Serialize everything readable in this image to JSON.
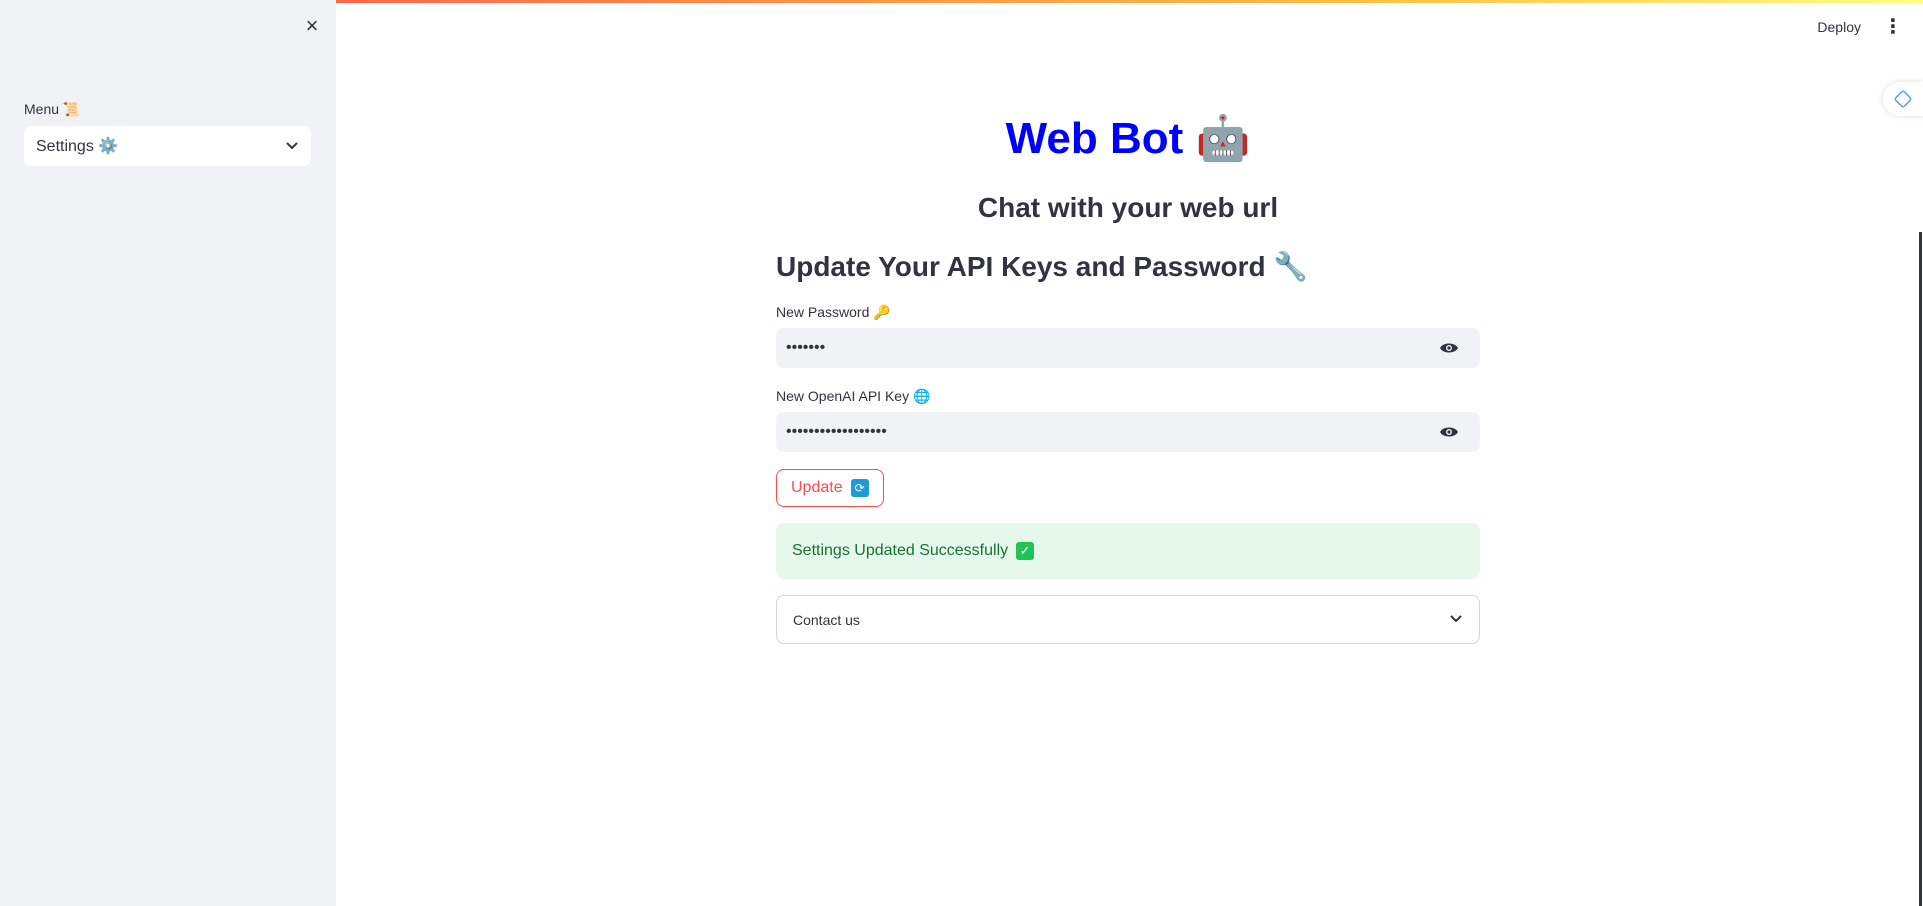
{
  "sidebar": {
    "close_icon": "×",
    "menu_label": "Menu 📜",
    "select_value": "Settings ⚙️",
    "chevron": "⌄"
  },
  "header": {
    "deploy_label": "Deploy",
    "more_icon": "⋮"
  },
  "main": {
    "title": "Web Bot",
    "title_emoji": "🤖",
    "subtitle": "Chat with your web url",
    "section_heading": "Update Your API Keys and Password 🔧",
    "password_label": "New Password 🔑",
    "password_value": "•••••••",
    "api_key_label": "New OpenAI API Key 🌐",
    "api_key_value": "••••••••••••••••••",
    "update_label": "Update",
    "update_icon": "🔄",
    "success_message": "Settings Updated Successfully",
    "success_icon": "✓",
    "expander_label": "Contact us"
  },
  "colors": {
    "title": "#0000ff",
    "accent": "#ff4b4b",
    "success_bg": "#e6f7eb",
    "success_text": "#177233",
    "sidebar_bg": "#f0f2f6"
  }
}
